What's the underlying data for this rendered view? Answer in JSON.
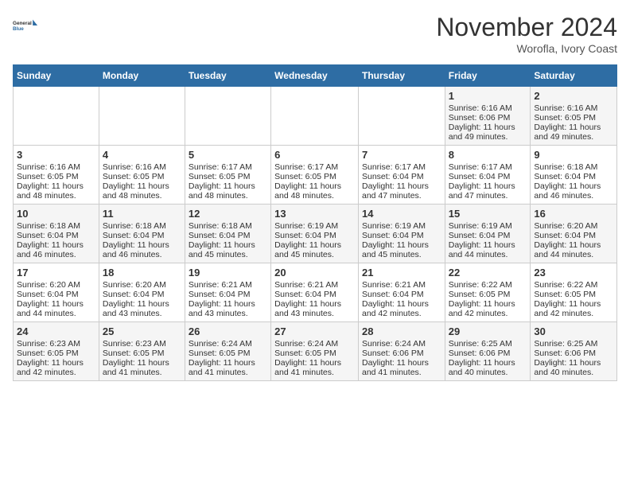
{
  "header": {
    "logo_line1": "General",
    "logo_line2": "Blue",
    "month": "November 2024",
    "location": "Worofla, Ivory Coast"
  },
  "weekdays": [
    "Sunday",
    "Monday",
    "Tuesday",
    "Wednesday",
    "Thursday",
    "Friday",
    "Saturday"
  ],
  "weeks": [
    [
      {
        "day": "",
        "info": ""
      },
      {
        "day": "",
        "info": ""
      },
      {
        "day": "",
        "info": ""
      },
      {
        "day": "",
        "info": ""
      },
      {
        "day": "",
        "info": ""
      },
      {
        "day": "1",
        "info": "Sunrise: 6:16 AM\nSunset: 6:06 PM\nDaylight: 11 hours and 49 minutes."
      },
      {
        "day": "2",
        "info": "Sunrise: 6:16 AM\nSunset: 6:05 PM\nDaylight: 11 hours and 49 minutes."
      }
    ],
    [
      {
        "day": "3",
        "info": "Sunrise: 6:16 AM\nSunset: 6:05 PM\nDaylight: 11 hours and 48 minutes."
      },
      {
        "day": "4",
        "info": "Sunrise: 6:16 AM\nSunset: 6:05 PM\nDaylight: 11 hours and 48 minutes."
      },
      {
        "day": "5",
        "info": "Sunrise: 6:17 AM\nSunset: 6:05 PM\nDaylight: 11 hours and 48 minutes."
      },
      {
        "day": "6",
        "info": "Sunrise: 6:17 AM\nSunset: 6:05 PM\nDaylight: 11 hours and 48 minutes."
      },
      {
        "day": "7",
        "info": "Sunrise: 6:17 AM\nSunset: 6:04 PM\nDaylight: 11 hours and 47 minutes."
      },
      {
        "day": "8",
        "info": "Sunrise: 6:17 AM\nSunset: 6:04 PM\nDaylight: 11 hours and 47 minutes."
      },
      {
        "day": "9",
        "info": "Sunrise: 6:18 AM\nSunset: 6:04 PM\nDaylight: 11 hours and 46 minutes."
      }
    ],
    [
      {
        "day": "10",
        "info": "Sunrise: 6:18 AM\nSunset: 6:04 PM\nDaylight: 11 hours and 46 minutes."
      },
      {
        "day": "11",
        "info": "Sunrise: 6:18 AM\nSunset: 6:04 PM\nDaylight: 11 hours and 46 minutes."
      },
      {
        "day": "12",
        "info": "Sunrise: 6:18 AM\nSunset: 6:04 PM\nDaylight: 11 hours and 45 minutes."
      },
      {
        "day": "13",
        "info": "Sunrise: 6:19 AM\nSunset: 6:04 PM\nDaylight: 11 hours and 45 minutes."
      },
      {
        "day": "14",
        "info": "Sunrise: 6:19 AM\nSunset: 6:04 PM\nDaylight: 11 hours and 45 minutes."
      },
      {
        "day": "15",
        "info": "Sunrise: 6:19 AM\nSunset: 6:04 PM\nDaylight: 11 hours and 44 minutes."
      },
      {
        "day": "16",
        "info": "Sunrise: 6:20 AM\nSunset: 6:04 PM\nDaylight: 11 hours and 44 minutes."
      }
    ],
    [
      {
        "day": "17",
        "info": "Sunrise: 6:20 AM\nSunset: 6:04 PM\nDaylight: 11 hours and 44 minutes."
      },
      {
        "day": "18",
        "info": "Sunrise: 6:20 AM\nSunset: 6:04 PM\nDaylight: 11 hours and 43 minutes."
      },
      {
        "day": "19",
        "info": "Sunrise: 6:21 AM\nSunset: 6:04 PM\nDaylight: 11 hours and 43 minutes."
      },
      {
        "day": "20",
        "info": "Sunrise: 6:21 AM\nSunset: 6:04 PM\nDaylight: 11 hours and 43 minutes."
      },
      {
        "day": "21",
        "info": "Sunrise: 6:21 AM\nSunset: 6:04 PM\nDaylight: 11 hours and 42 minutes."
      },
      {
        "day": "22",
        "info": "Sunrise: 6:22 AM\nSunset: 6:05 PM\nDaylight: 11 hours and 42 minutes."
      },
      {
        "day": "23",
        "info": "Sunrise: 6:22 AM\nSunset: 6:05 PM\nDaylight: 11 hours and 42 minutes."
      }
    ],
    [
      {
        "day": "24",
        "info": "Sunrise: 6:23 AM\nSunset: 6:05 PM\nDaylight: 11 hours and 42 minutes."
      },
      {
        "day": "25",
        "info": "Sunrise: 6:23 AM\nSunset: 6:05 PM\nDaylight: 11 hours and 41 minutes."
      },
      {
        "day": "26",
        "info": "Sunrise: 6:24 AM\nSunset: 6:05 PM\nDaylight: 11 hours and 41 minutes."
      },
      {
        "day": "27",
        "info": "Sunrise: 6:24 AM\nSunset: 6:05 PM\nDaylight: 11 hours and 41 minutes."
      },
      {
        "day": "28",
        "info": "Sunrise: 6:24 AM\nSunset: 6:06 PM\nDaylight: 11 hours and 41 minutes."
      },
      {
        "day": "29",
        "info": "Sunrise: 6:25 AM\nSunset: 6:06 PM\nDaylight: 11 hours and 40 minutes."
      },
      {
        "day": "30",
        "info": "Sunrise: 6:25 AM\nSunset: 6:06 PM\nDaylight: 11 hours and 40 minutes."
      }
    ]
  ]
}
